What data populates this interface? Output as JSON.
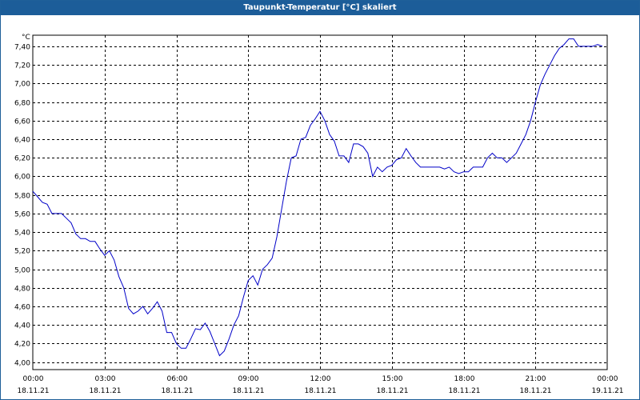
{
  "window": {
    "title": "Taupunkt-Temperatur [°C] skaliert"
  },
  "chart_data": {
    "type": "line",
    "title": "Taupunkt-Temperatur [°C] skaliert",
    "ylabel": "°C",
    "xlabel": "",
    "ylim": [
      3.92,
      7.52
    ],
    "xlim": [
      0,
      24
    ],
    "grid": true,
    "line_color": "#0000c8",
    "y_ticks": [
      "4,00",
      "4,20",
      "4,40",
      "4,60",
      "4,80",
      "5,00",
      "5,20",
      "5,40",
      "5,60",
      "5,80",
      "6,00",
      "6,20",
      "6,40",
      "6,60",
      "6,80",
      "7,00",
      "7,20",
      "7,40"
    ],
    "x_ticks": [
      {
        "time": "00:00",
        "date": "18.11.21"
      },
      {
        "time": "03:00",
        "date": "18.11.21"
      },
      {
        "time": "06:00",
        "date": "18.11.21"
      },
      {
        "time": "09:00",
        "date": "18.11.21"
      },
      {
        "time": "12:00",
        "date": "18.11.21"
      },
      {
        "time": "15:00",
        "date": "18.11.21"
      },
      {
        "time": "18:00",
        "date": "18.11.21"
      },
      {
        "time": "21:00",
        "date": "18.11.21"
      },
      {
        "time": "00:00",
        "date": "19.11.21"
      }
    ],
    "series": [
      {
        "x": [
          0.0,
          0.2,
          0.4,
          0.6,
          0.8,
          1.0,
          1.2,
          1.4,
          1.6,
          1.8,
          2.0,
          2.2,
          2.4,
          2.6,
          2.8,
          3.0,
          3.2,
          3.4,
          3.6,
          3.8,
          4.0,
          4.2,
          4.4,
          4.6,
          4.8,
          5.0,
          5.2,
          5.4,
          5.6,
          5.8,
          6.0,
          6.2,
          6.4,
          6.6,
          6.8,
          7.0,
          7.2,
          7.4,
          7.6,
          7.8,
          8.0,
          8.2,
          8.4,
          8.6,
          8.8,
          9.0,
          9.2,
          9.4,
          9.6,
          9.8,
          10.0,
          10.2,
          10.4,
          10.6,
          10.8,
          11.0,
          11.2,
          11.4,
          11.6,
          11.8,
          12.0,
          12.2,
          12.4,
          12.6,
          12.8,
          13.0,
          13.2,
          13.4,
          13.6,
          13.8,
          14.0,
          14.2,
          14.4,
          14.6,
          14.8,
          15.0,
          15.2,
          15.4,
          15.6,
          15.8,
          16.0,
          16.2,
          16.4,
          16.6,
          16.8,
          17.0,
          17.2,
          17.4,
          17.6,
          17.8,
          18.0,
          18.2,
          18.4,
          18.6,
          18.8,
          19.0,
          19.2,
          19.4,
          19.6,
          19.8,
          20.0,
          20.2,
          20.4,
          20.6,
          20.8,
          21.0,
          21.2,
          21.4,
          21.6,
          21.8,
          22.0,
          22.2,
          22.4,
          22.6,
          22.8,
          23.0,
          23.2,
          23.4,
          23.6,
          23.8
        ],
        "y": [
          5.84,
          5.78,
          5.72,
          5.7,
          5.6,
          5.6,
          5.6,
          5.55,
          5.5,
          5.38,
          5.33,
          5.33,
          5.3,
          5.3,
          5.22,
          5.15,
          5.2,
          5.1,
          4.92,
          4.8,
          4.58,
          4.52,
          4.55,
          4.6,
          4.52,
          4.58,
          4.65,
          4.55,
          4.32,
          4.32,
          4.2,
          4.15,
          4.15,
          4.25,
          4.36,
          4.35,
          4.42,
          4.33,
          4.2,
          4.07,
          4.12,
          4.25,
          4.4,
          4.5,
          4.7,
          4.88,
          4.93,
          4.83,
          5.0,
          5.05,
          5.12,
          5.35,
          5.65,
          5.95,
          6.2,
          6.22,
          6.4,
          6.42,
          6.55,
          6.62,
          6.7,
          6.6,
          6.45,
          6.38,
          6.22,
          6.22,
          6.15,
          6.35,
          6.35,
          6.32,
          6.25,
          6.0,
          6.1,
          6.05,
          6.1,
          6.12,
          6.18,
          6.2,
          6.3,
          6.22,
          6.15,
          6.1,
          6.1,
          6.1,
          6.1,
          6.1,
          6.08,
          6.1,
          6.05,
          6.03,
          6.05,
          6.05,
          6.1,
          6.1,
          6.1,
          6.2,
          6.25,
          6.2,
          6.2,
          6.15,
          6.2,
          6.25,
          6.35,
          6.45,
          6.6,
          6.8,
          6.98,
          7.1,
          7.2,
          7.3,
          7.38,
          7.42,
          7.48,
          7.48,
          7.4,
          7.4,
          7.4,
          7.4,
          7.42,
          7.4
        ]
      }
    ]
  }
}
